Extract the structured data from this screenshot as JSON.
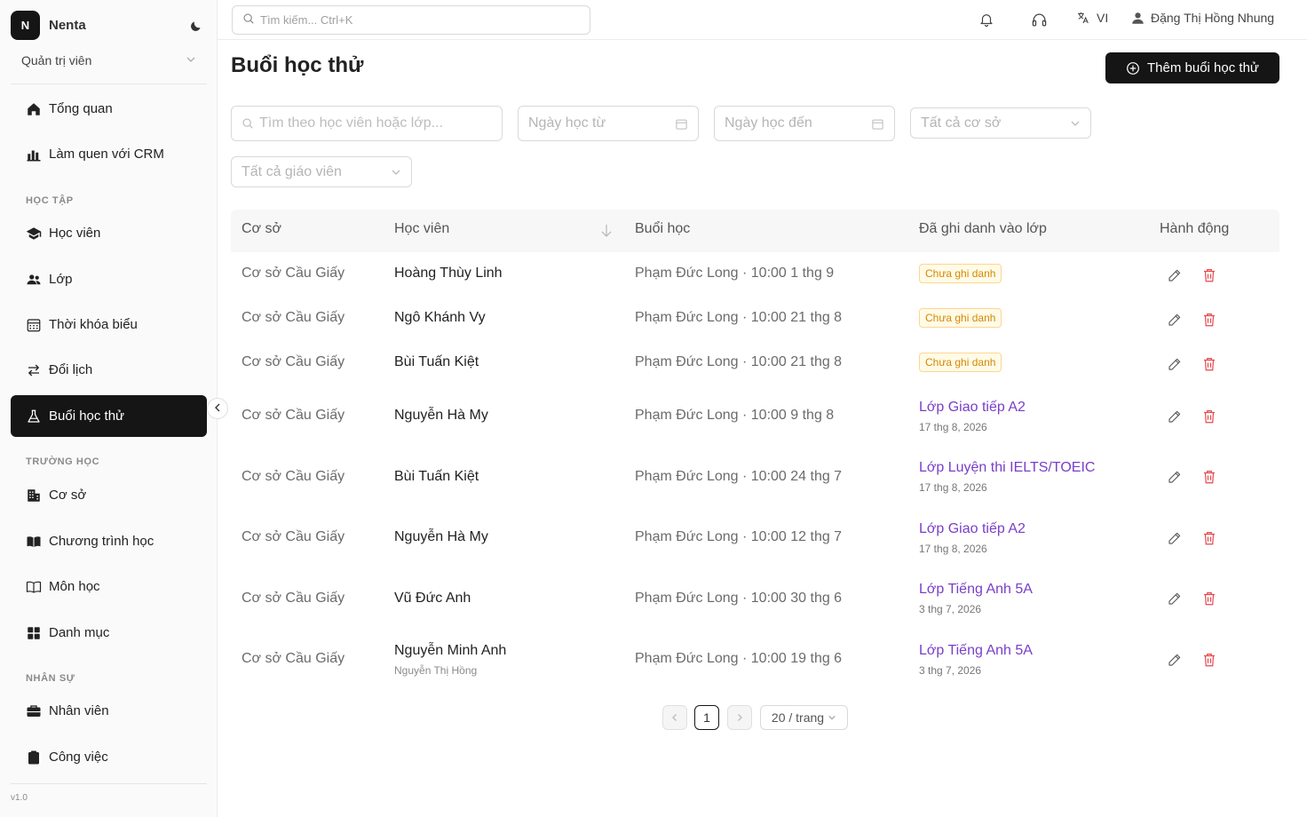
{
  "app": {
    "logo_letter": "N",
    "name": "Nenta",
    "role": "Quản trị viên",
    "version": "v1.0"
  },
  "sidebar": {
    "items": [
      {
        "label": "Tổng quan",
        "icon": "home-icon"
      },
      {
        "label": "Làm quen với CRM",
        "icon": "chart-icon"
      },
      {
        "label": "Học viên",
        "icon": "graduation-cap-icon"
      },
      {
        "label": "Lớp",
        "icon": "users-icon"
      },
      {
        "label": "Thời khóa biểu",
        "icon": "calendar-icon"
      },
      {
        "label": "Đổi lịch",
        "icon": "swap-icon"
      },
      {
        "label": "Buổi học thử",
        "icon": "flask-icon",
        "active": true
      },
      {
        "label": "Cơ sở",
        "icon": "building-icon"
      },
      {
        "label": "Chương trình học",
        "icon": "book-icon"
      },
      {
        "label": "Môn học",
        "icon": "open-book-icon"
      },
      {
        "label": "Danh mục",
        "icon": "grid-icon"
      },
      {
        "label": "Nhân viên",
        "icon": "briefcase-icon"
      },
      {
        "label": "Công việc",
        "icon": "clipboard-icon"
      }
    ],
    "sections": [
      "HỌC TẬP",
      "TRƯỜNG HỌC",
      "NHÂN SỰ"
    ]
  },
  "header": {
    "search_placeholder": "Tìm kiếm... Ctrl+K",
    "language": "VI",
    "user_name": "Đặng Thị Hồng Nhung"
  },
  "page": {
    "title": "Buổi học thử",
    "add_button": "Thêm buổi học thử"
  },
  "filters": {
    "search_placeholder": "Tìm theo học viên hoặc lớp...",
    "date_from": "Ngày học từ",
    "date_to": "Ngày học đến",
    "campus": "Tất cả cơ sở",
    "teacher": "Tất cả giáo viên"
  },
  "table": {
    "headers": [
      "Cơ sở",
      "Học viên",
      "Buổi học",
      "Đã ghi danh vào lớp",
      "Hành động"
    ],
    "rows": [
      {
        "campus": "Cơ sở Cầu Giấy",
        "student": "Hoàng Thùy Linh",
        "session": "Phạm Đức Long · 10:00 1 thg 9",
        "status": "Chưa ghi danh"
      },
      {
        "campus": "Cơ sở Cầu Giấy",
        "student": "Ngô Khánh Vy",
        "session": "Phạm Đức Long · 10:00 21 thg 8",
        "status": "Chưa ghi danh"
      },
      {
        "campus": "Cơ sở Cầu Giấy",
        "student": "Bùi Tuấn Kiệt",
        "session": "Phạm Đức Long · 10:00 21 thg 8",
        "status": "Chưa ghi danh"
      },
      {
        "campus": "Cơ sở Cầu Giấy",
        "student": "Nguyễn Hà My",
        "session": "Phạm Đức Long · 10:00 9 thg 8",
        "class": "Lớp Giao tiếp A2",
        "class_date": "17 thg 8, 2026"
      },
      {
        "campus": "Cơ sở Cầu Giấy",
        "student": "Bùi Tuấn Kiệt",
        "session": "Phạm Đức Long · 10:00 24 thg 7",
        "class": "Lớp Luyện thi IELTS/TOEIC",
        "class_date": "17 thg 8, 2026"
      },
      {
        "campus": "Cơ sở Cầu Giấy",
        "student": "Nguyễn Hà My",
        "session": "Phạm Đức Long · 10:00 12 thg 7",
        "class": "Lớp Giao tiếp A2",
        "class_date": "17 thg 8, 2026"
      },
      {
        "campus": "Cơ sở Cầu Giấy",
        "student": "Vũ Đức Anh",
        "session": "Phạm Đức Long · 10:00 30 thg 6",
        "class": "Lớp Tiếng Anh 5A",
        "class_date": "3 thg 7, 2026"
      },
      {
        "campus": "Cơ sở Cầu Giấy",
        "student": "Nguyễn Minh Anh",
        "student_sub": "Nguyễn Thị Hồng",
        "session": "Phạm Đức Long · 10:00 19 thg 6",
        "class": "Lớp Tiếng Anh 5A",
        "class_date": "3 thg 7, 2026"
      }
    ]
  },
  "pagination": {
    "current": "1",
    "page_size": "20 / trang"
  },
  "colors": {
    "primary": "#151515",
    "link": "#7a3ec8",
    "danger": "#e5484d",
    "warning": "#d48806"
  }
}
